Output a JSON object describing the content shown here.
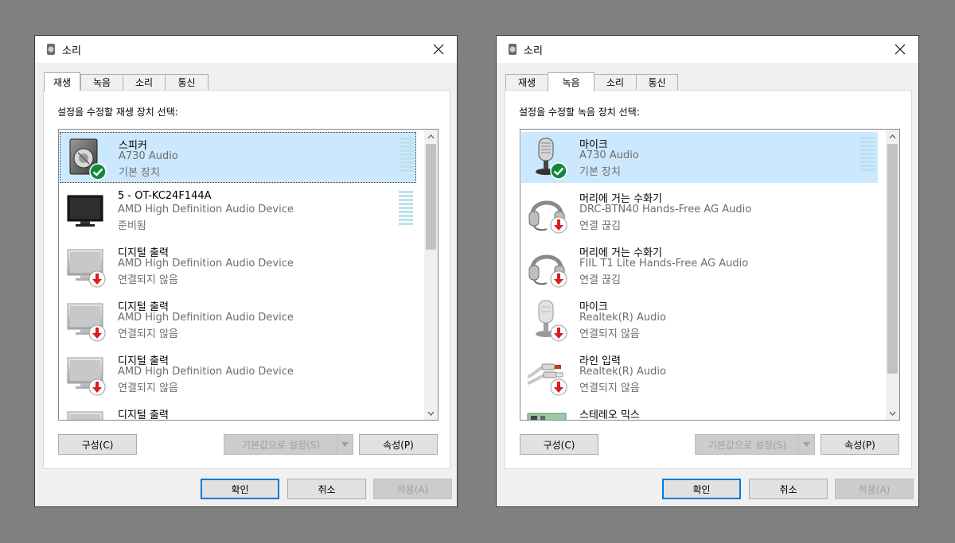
{
  "left": {
    "title": "소리",
    "tabs": [
      "재생",
      "녹음",
      "소리",
      "통신"
    ],
    "active_tab": 0,
    "instruction": "설정을 수정할 재생 장치 선택:",
    "devices": [
      {
        "name": "스피커",
        "desc": "A730 Audio",
        "status": "기본 장치",
        "icon": "speaker-icon",
        "badge": "default-check-icon"
      },
      {
        "name": "5 - OT-KC24F144A",
        "desc": "AMD High Definition Audio Device",
        "status": "준비됨",
        "icon": "monitor-icon",
        "badge": ""
      },
      {
        "name": "디지털 출력",
        "desc": "AMD High Definition Audio Device",
        "status": "연결되지 않음",
        "icon": "monitor-disabled-icon",
        "badge": "disconnected-arrow-icon"
      },
      {
        "name": "디지털 출력",
        "desc": "AMD High Definition Audio Device",
        "status": "연결되지 않음",
        "icon": "monitor-disabled-icon",
        "badge": "disconnected-arrow-icon"
      },
      {
        "name": "디지털 출력",
        "desc": "AMD High Definition Audio Device",
        "status": "연결되지 않음",
        "icon": "monitor-disabled-icon",
        "badge": "disconnected-arrow-icon"
      },
      {
        "name": "디지털 출력",
        "desc": "",
        "status": "",
        "icon": "monitor-disabled-icon",
        "badge": ""
      }
    ],
    "buttons": {
      "configure": "구성(C)",
      "set_default": "기본값으로 설정(S)",
      "properties": "속성(P)",
      "ok": "확인",
      "cancel": "취소",
      "apply": "적용(A)"
    }
  },
  "right": {
    "title": "소리",
    "tabs": [
      "재생",
      "녹음",
      "소리",
      "통신"
    ],
    "active_tab": 1,
    "instruction": "설정을 수정할 녹음 장치 선택:",
    "devices": [
      {
        "name": "마이크",
        "desc": "A730 Audio",
        "status": "기본 장치",
        "icon": "microphone-icon",
        "badge": "default-check-icon"
      },
      {
        "name": "머리에 거는 수화기",
        "desc": "DRC-BTN40 Hands-Free AG Audio",
        "status": "연결 끊김",
        "icon": "headset-icon",
        "badge": "disconnected-arrow-icon"
      },
      {
        "name": "머리에 거는 수화기",
        "desc": "FIIL T1 Lite Hands-Free AG Audio",
        "status": "연결 끊김",
        "icon": "headset-icon",
        "badge": "disconnected-arrow-icon"
      },
      {
        "name": "마이크",
        "desc": "Realtek(R) Audio",
        "status": "연결되지 않음",
        "icon": "microphone-disabled-icon",
        "badge": "disconnected-arrow-icon"
      },
      {
        "name": "라인 입력",
        "desc": "Realtek(R) Audio",
        "status": "연결되지 않음",
        "icon": "line-in-cable-icon",
        "badge": "disconnected-arrow-icon"
      },
      {
        "name": "스테레오 믹스",
        "desc": "",
        "status": "",
        "icon": "board-icon",
        "badge": ""
      }
    ],
    "buttons": {
      "configure": "구성(C)",
      "set_default": "기본값으로 설정(S)",
      "properties": "속성(P)",
      "ok": "확인",
      "cancel": "취소",
      "apply": "적용(A)"
    }
  },
  "colors": {
    "selection": "#cce8ff",
    "check_green": "#10893e",
    "disconnect_red": "#d81e1e",
    "focus_blue": "#0078d7"
  }
}
